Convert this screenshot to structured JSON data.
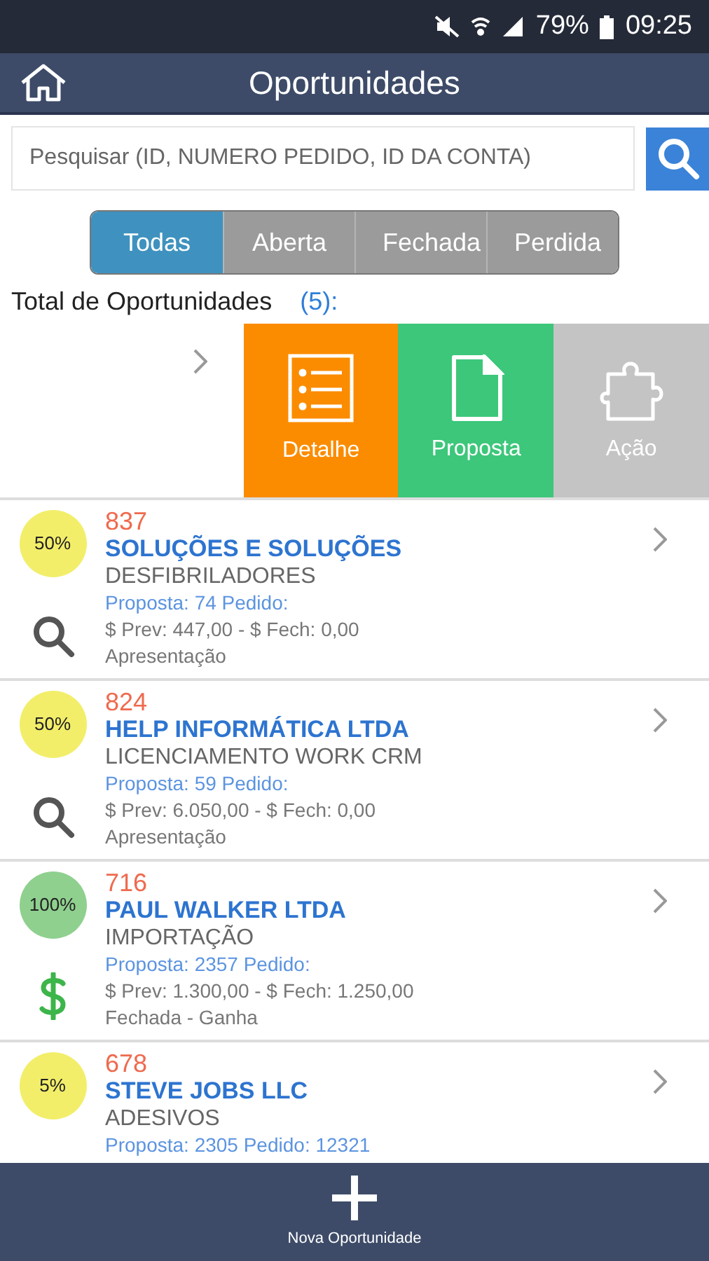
{
  "status_bar": {
    "battery": "79%",
    "time": "09:25"
  },
  "header": {
    "title": "Oportunidades"
  },
  "search": {
    "placeholder": "Pesquisar (ID, NUMERO PEDIDO, ID DA CONTA)"
  },
  "tabs": [
    {
      "label": "Todas",
      "selected": true
    },
    {
      "label": "Aberta",
      "selected": false
    },
    {
      "label": "Fechada",
      "selected": false
    },
    {
      "label": "Perdida",
      "selected": false
    }
  ],
  "total": {
    "label": "Total de Oportunidades",
    "count": "(5):"
  },
  "swipe_actions": [
    {
      "kind": "list",
      "label": "Detalhe",
      "color": "#fb8c00"
    },
    {
      "kind": "document",
      "label": "Proposta",
      "color": "#3cc77a"
    },
    {
      "kind": "puzzle",
      "label": "Ação",
      "color": "#c4c4c4"
    }
  ],
  "opportunities": [
    {
      "percent": "50%",
      "color": "#f2ee6a",
      "kind": "open",
      "id": "837",
      "name": "SOLUÇÕES E SOLUÇÕES",
      "product": "DESFIBRILADORES",
      "proposal": "Proposta: 74 Pedido:",
      "values": "$ Prev: 447,00 - $ Fech: 0,00",
      "stage": "Apresentação"
    },
    {
      "percent": "50%",
      "color": "#f2ee6a",
      "kind": "open",
      "id": "824",
      "name": "HELP INFORMÁTICA LTDA",
      "product": "LICENCIAMENTO WORK CRM",
      "proposal": "Proposta: 59 Pedido:",
      "values": "$ Prev: 6.050,00 - $ Fech: 0,00",
      "stage": "Apresentação"
    },
    {
      "percent": "100%",
      "color": "#8fd08f",
      "kind": "won",
      "id": "716",
      "name": "PAUL WALKER LTDA",
      "product": "IMPORTAÇÃO",
      "proposal": "Proposta: 2357 Pedido:",
      "values": "$ Prev: 1.300,00 - $ Fech: 1.250,00",
      "stage": "Fechada - Ganha"
    },
    {
      "percent": "5%",
      "color": "#f2ee6a",
      "id": "678",
      "name": "STEVE JOBS LLC",
      "product": "ADESIVOS",
      "proposal": "Proposta: 2305 Pedido: 12321"
    }
  ],
  "footer": {
    "label": "Nova Oportunidade"
  }
}
